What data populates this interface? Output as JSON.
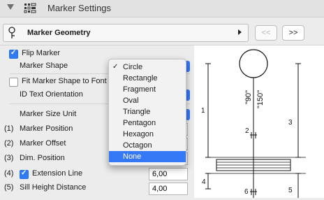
{
  "header": {
    "title": "Marker Settings"
  },
  "geometry": {
    "label": "Marker Geometry",
    "prev_label": "<<",
    "next_label": ">>"
  },
  "settings": {
    "flip_marker": {
      "label": "Flip Marker",
      "checked": true
    },
    "marker_shape": {
      "label": "Marker Shape"
    },
    "fit_marker": {
      "label": "Fit Marker Shape to Font",
      "checked": false
    },
    "id_text_orientation": {
      "label": "ID Text Orientation"
    },
    "marker_size_unit": {
      "label": "Marker Size Unit"
    },
    "marker_position": {
      "num": "(1)",
      "label": "Marker Position"
    },
    "marker_offset": {
      "num": "(2)",
      "label": "Marker Offset"
    },
    "dim_position": {
      "num": "(3)",
      "label": "Dim. Position"
    },
    "extension_line": {
      "num": "(4)",
      "label": "Extension Line",
      "checked": true,
      "value": "6,00"
    },
    "sill_height": {
      "num": "(5)",
      "label": "Sill Height Distance",
      "value": "4,00"
    }
  },
  "shape_menu": {
    "items": [
      "Circle",
      "Rectangle",
      "Fragment",
      "Oval",
      "Triangle",
      "Pentagon",
      "Hexagon",
      "Octagon",
      "None"
    ],
    "checked": "Circle",
    "highlighted": "None"
  },
  "preview": {
    "label_90": "\"90\"",
    "label_150": "\"150\"",
    "dim_1": "1",
    "dim_2": "2",
    "dim_3": "3",
    "dim_4": "4",
    "dim_5": "5",
    "dim_6": "6"
  },
  "colors": {
    "accent": "#3478f6",
    "check_blue": "#2f7bf5"
  }
}
